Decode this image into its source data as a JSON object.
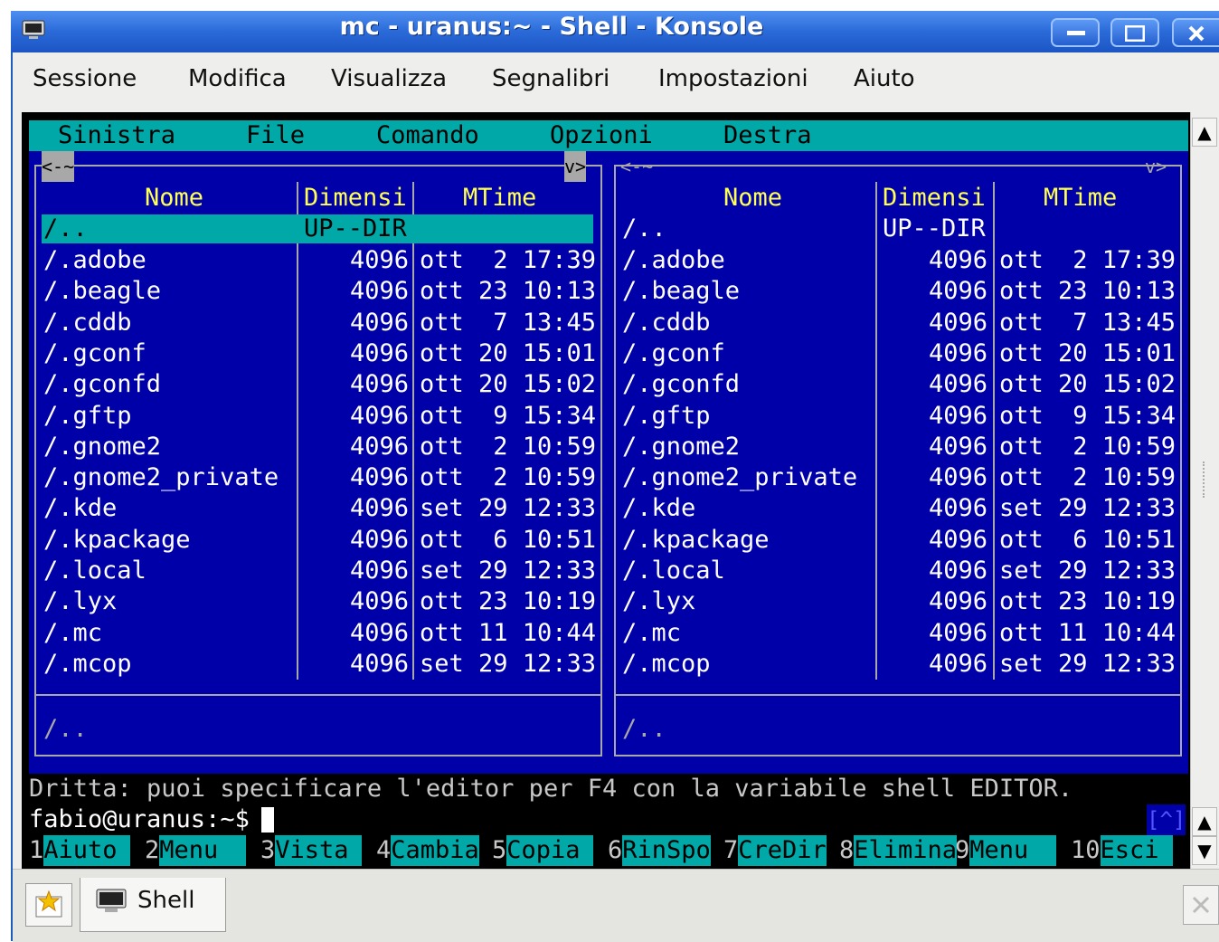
{
  "window": {
    "title": "mc - uranus:~ - Shell - Konsole"
  },
  "menubar": {
    "items": [
      "Sessione",
      "Modifica",
      "Visualizza",
      "Segnalibri",
      "Impostazioni",
      "Aiuto"
    ]
  },
  "mc_menu": {
    "items": [
      "Sinistra",
      "File",
      "Comando",
      "Opzioni",
      "Destra"
    ]
  },
  "panel_left": {
    "nav": "<-~",
    "nav_right": "v>",
    "columns": [
      "Nome",
      "Dimensi",
      "MTime"
    ],
    "updir": {
      "name": "/..",
      "size": "UP--DIR",
      "mtime": ""
    },
    "rows": [
      {
        "name": "/.adobe",
        "size": "4096",
        "mtime": "ott  2 17:39"
      },
      {
        "name": "/.beagle",
        "size": "4096",
        "mtime": "ott 23 10:13"
      },
      {
        "name": "/.cddb",
        "size": "4096",
        "mtime": "ott  7 13:45"
      },
      {
        "name": "/.gconf",
        "size": "4096",
        "mtime": "ott 20 15:01"
      },
      {
        "name": "/.gconfd",
        "size": "4096",
        "mtime": "ott 20 15:02"
      },
      {
        "name": "/.gftp",
        "size": "4096",
        "mtime": "ott  9 15:34"
      },
      {
        "name": "/.gnome2",
        "size": "4096",
        "mtime": "ott  2 10:59"
      },
      {
        "name": "/.gnome2_private",
        "size": "4096",
        "mtime": "ott  2 10:59"
      },
      {
        "name": "/.kde",
        "size": "4096",
        "mtime": "set 29 12:33"
      },
      {
        "name": "/.kpackage",
        "size": "4096",
        "mtime": "ott  6 10:51"
      },
      {
        "name": "/.local",
        "size": "4096",
        "mtime": "set 29 12:33"
      },
      {
        "name": "/.lyx",
        "size": "4096",
        "mtime": "ott 23 10:19"
      },
      {
        "name": "/.mc",
        "size": "4096",
        "mtime": "ott 11 10:44"
      },
      {
        "name": "/.mcop",
        "size": "4096",
        "mtime": "set 29 12:33"
      }
    ],
    "status": "/.."
  },
  "panel_right": {
    "nav": "<-~",
    "nav_right": "v>",
    "columns": [
      "Nome",
      "Dimensi",
      "MTime"
    ],
    "updir": {
      "name": "/..",
      "size": "UP--DIR",
      "mtime": ""
    },
    "rows": [
      {
        "name": "/.adobe",
        "size": "4096",
        "mtime": "ott  2 17:39"
      },
      {
        "name": "/.beagle",
        "size": "4096",
        "mtime": "ott 23 10:13"
      },
      {
        "name": "/.cddb",
        "size": "4096",
        "mtime": "ott  7 13:45"
      },
      {
        "name": "/.gconf",
        "size": "4096",
        "mtime": "ott 20 15:01"
      },
      {
        "name": "/.gconfd",
        "size": "4096",
        "mtime": "ott 20 15:02"
      },
      {
        "name": "/.gftp",
        "size": "4096",
        "mtime": "ott  9 15:34"
      },
      {
        "name": "/.gnome2",
        "size": "4096",
        "mtime": "ott  2 10:59"
      },
      {
        "name": "/.gnome2_private",
        "size": "4096",
        "mtime": "ott  2 10:59"
      },
      {
        "name": "/.kde",
        "size": "4096",
        "mtime": "set 29 12:33"
      },
      {
        "name": "/.kpackage",
        "size": "4096",
        "mtime": "ott  6 10:51"
      },
      {
        "name": "/.local",
        "size": "4096",
        "mtime": "set 29 12:33"
      },
      {
        "name": "/.lyx",
        "size": "4096",
        "mtime": "ott 23 10:19"
      },
      {
        "name": "/.mc",
        "size": "4096",
        "mtime": "ott 11 10:44"
      },
      {
        "name": "/.mcop",
        "size": "4096",
        "mtime": "set 29 12:33"
      }
    ],
    "status": "/.."
  },
  "hint": "Dritta: puoi specificare l'editor per F4 con la variabile shell EDITOR.",
  "prompt": "fabio@uranus:~$",
  "history_button": "[^]",
  "fkeys": [
    {
      "num": "1",
      "label": "Aiuto"
    },
    {
      "num": "2",
      "label": "Menu"
    },
    {
      "num": "3",
      "label": "Vista"
    },
    {
      "num": "4",
      "label": "Cambia"
    },
    {
      "num": "5",
      "label": "Copia"
    },
    {
      "num": "6",
      "label": "RinSpo"
    },
    {
      "num": "7",
      "label": "CreDir"
    },
    {
      "num": "8",
      "label": "Elimina"
    },
    {
      "num": "9",
      "label": "Menu"
    },
    {
      "num": "10",
      "label": "Esci"
    }
  ],
  "tabs": [
    {
      "label": "Shell"
    }
  ],
  "colors": {
    "panel_bg": "#0000a8",
    "accent_cyan": "#00a8a8",
    "header_yellow": "#ffff55",
    "titlebar": "#2a6ad8"
  },
  "icons": {
    "window": "terminal-icon",
    "new_tab": "new-session-icon",
    "tab": "terminal-icon",
    "close_tab": "close-tab-icon"
  }
}
